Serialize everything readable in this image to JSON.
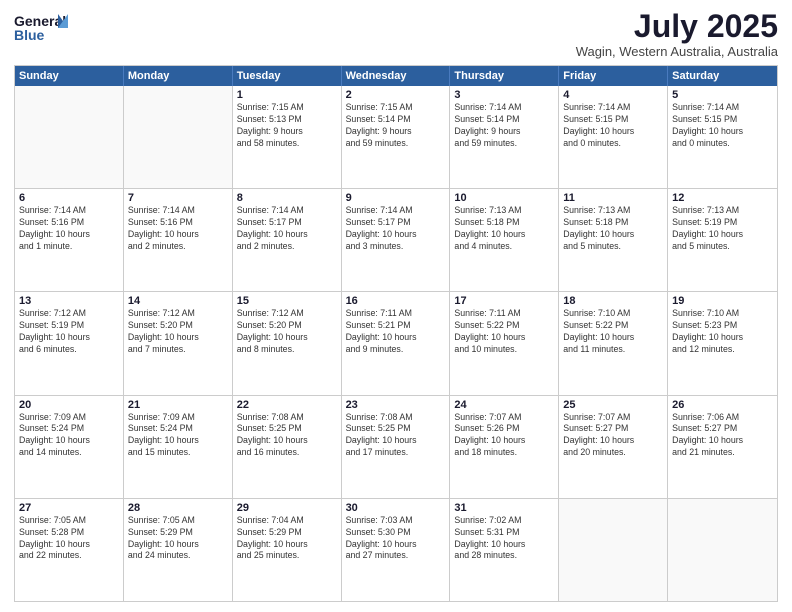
{
  "logo": {
    "line1": "General",
    "line2": "Blue",
    "icon_color": "#2c5f9e"
  },
  "title": "July 2025",
  "location": "Wagin, Western Australia, Australia",
  "header_days": [
    "Sunday",
    "Monday",
    "Tuesday",
    "Wednesday",
    "Thursday",
    "Friday",
    "Saturday"
  ],
  "weeks": [
    [
      {
        "day": "",
        "text": ""
      },
      {
        "day": "",
        "text": ""
      },
      {
        "day": "1",
        "text": "Sunrise: 7:15 AM\nSunset: 5:13 PM\nDaylight: 9 hours\nand 58 minutes."
      },
      {
        "day": "2",
        "text": "Sunrise: 7:15 AM\nSunset: 5:14 PM\nDaylight: 9 hours\nand 59 minutes."
      },
      {
        "day": "3",
        "text": "Sunrise: 7:14 AM\nSunset: 5:14 PM\nDaylight: 9 hours\nand 59 minutes."
      },
      {
        "day": "4",
        "text": "Sunrise: 7:14 AM\nSunset: 5:15 PM\nDaylight: 10 hours\nand 0 minutes."
      },
      {
        "day": "5",
        "text": "Sunrise: 7:14 AM\nSunset: 5:15 PM\nDaylight: 10 hours\nand 0 minutes."
      }
    ],
    [
      {
        "day": "6",
        "text": "Sunrise: 7:14 AM\nSunset: 5:16 PM\nDaylight: 10 hours\nand 1 minute."
      },
      {
        "day": "7",
        "text": "Sunrise: 7:14 AM\nSunset: 5:16 PM\nDaylight: 10 hours\nand 2 minutes."
      },
      {
        "day": "8",
        "text": "Sunrise: 7:14 AM\nSunset: 5:17 PM\nDaylight: 10 hours\nand 2 minutes."
      },
      {
        "day": "9",
        "text": "Sunrise: 7:14 AM\nSunset: 5:17 PM\nDaylight: 10 hours\nand 3 minutes."
      },
      {
        "day": "10",
        "text": "Sunrise: 7:13 AM\nSunset: 5:18 PM\nDaylight: 10 hours\nand 4 minutes."
      },
      {
        "day": "11",
        "text": "Sunrise: 7:13 AM\nSunset: 5:18 PM\nDaylight: 10 hours\nand 5 minutes."
      },
      {
        "day": "12",
        "text": "Sunrise: 7:13 AM\nSunset: 5:19 PM\nDaylight: 10 hours\nand 5 minutes."
      }
    ],
    [
      {
        "day": "13",
        "text": "Sunrise: 7:12 AM\nSunset: 5:19 PM\nDaylight: 10 hours\nand 6 minutes."
      },
      {
        "day": "14",
        "text": "Sunrise: 7:12 AM\nSunset: 5:20 PM\nDaylight: 10 hours\nand 7 minutes."
      },
      {
        "day": "15",
        "text": "Sunrise: 7:12 AM\nSunset: 5:20 PM\nDaylight: 10 hours\nand 8 minutes."
      },
      {
        "day": "16",
        "text": "Sunrise: 7:11 AM\nSunset: 5:21 PM\nDaylight: 10 hours\nand 9 minutes."
      },
      {
        "day": "17",
        "text": "Sunrise: 7:11 AM\nSunset: 5:22 PM\nDaylight: 10 hours\nand 10 minutes."
      },
      {
        "day": "18",
        "text": "Sunrise: 7:10 AM\nSunset: 5:22 PM\nDaylight: 10 hours\nand 11 minutes."
      },
      {
        "day": "19",
        "text": "Sunrise: 7:10 AM\nSunset: 5:23 PM\nDaylight: 10 hours\nand 12 minutes."
      }
    ],
    [
      {
        "day": "20",
        "text": "Sunrise: 7:09 AM\nSunset: 5:24 PM\nDaylight: 10 hours\nand 14 minutes."
      },
      {
        "day": "21",
        "text": "Sunrise: 7:09 AM\nSunset: 5:24 PM\nDaylight: 10 hours\nand 15 minutes."
      },
      {
        "day": "22",
        "text": "Sunrise: 7:08 AM\nSunset: 5:25 PM\nDaylight: 10 hours\nand 16 minutes."
      },
      {
        "day": "23",
        "text": "Sunrise: 7:08 AM\nSunset: 5:25 PM\nDaylight: 10 hours\nand 17 minutes."
      },
      {
        "day": "24",
        "text": "Sunrise: 7:07 AM\nSunset: 5:26 PM\nDaylight: 10 hours\nand 18 minutes."
      },
      {
        "day": "25",
        "text": "Sunrise: 7:07 AM\nSunset: 5:27 PM\nDaylight: 10 hours\nand 20 minutes."
      },
      {
        "day": "26",
        "text": "Sunrise: 7:06 AM\nSunset: 5:27 PM\nDaylight: 10 hours\nand 21 minutes."
      }
    ],
    [
      {
        "day": "27",
        "text": "Sunrise: 7:05 AM\nSunset: 5:28 PM\nDaylight: 10 hours\nand 22 minutes."
      },
      {
        "day": "28",
        "text": "Sunrise: 7:05 AM\nSunset: 5:29 PM\nDaylight: 10 hours\nand 24 minutes."
      },
      {
        "day": "29",
        "text": "Sunrise: 7:04 AM\nSunset: 5:29 PM\nDaylight: 10 hours\nand 25 minutes."
      },
      {
        "day": "30",
        "text": "Sunrise: 7:03 AM\nSunset: 5:30 PM\nDaylight: 10 hours\nand 27 minutes."
      },
      {
        "day": "31",
        "text": "Sunrise: 7:02 AM\nSunset: 5:31 PM\nDaylight: 10 hours\nand 28 minutes."
      },
      {
        "day": "",
        "text": ""
      },
      {
        "day": "",
        "text": ""
      }
    ]
  ]
}
